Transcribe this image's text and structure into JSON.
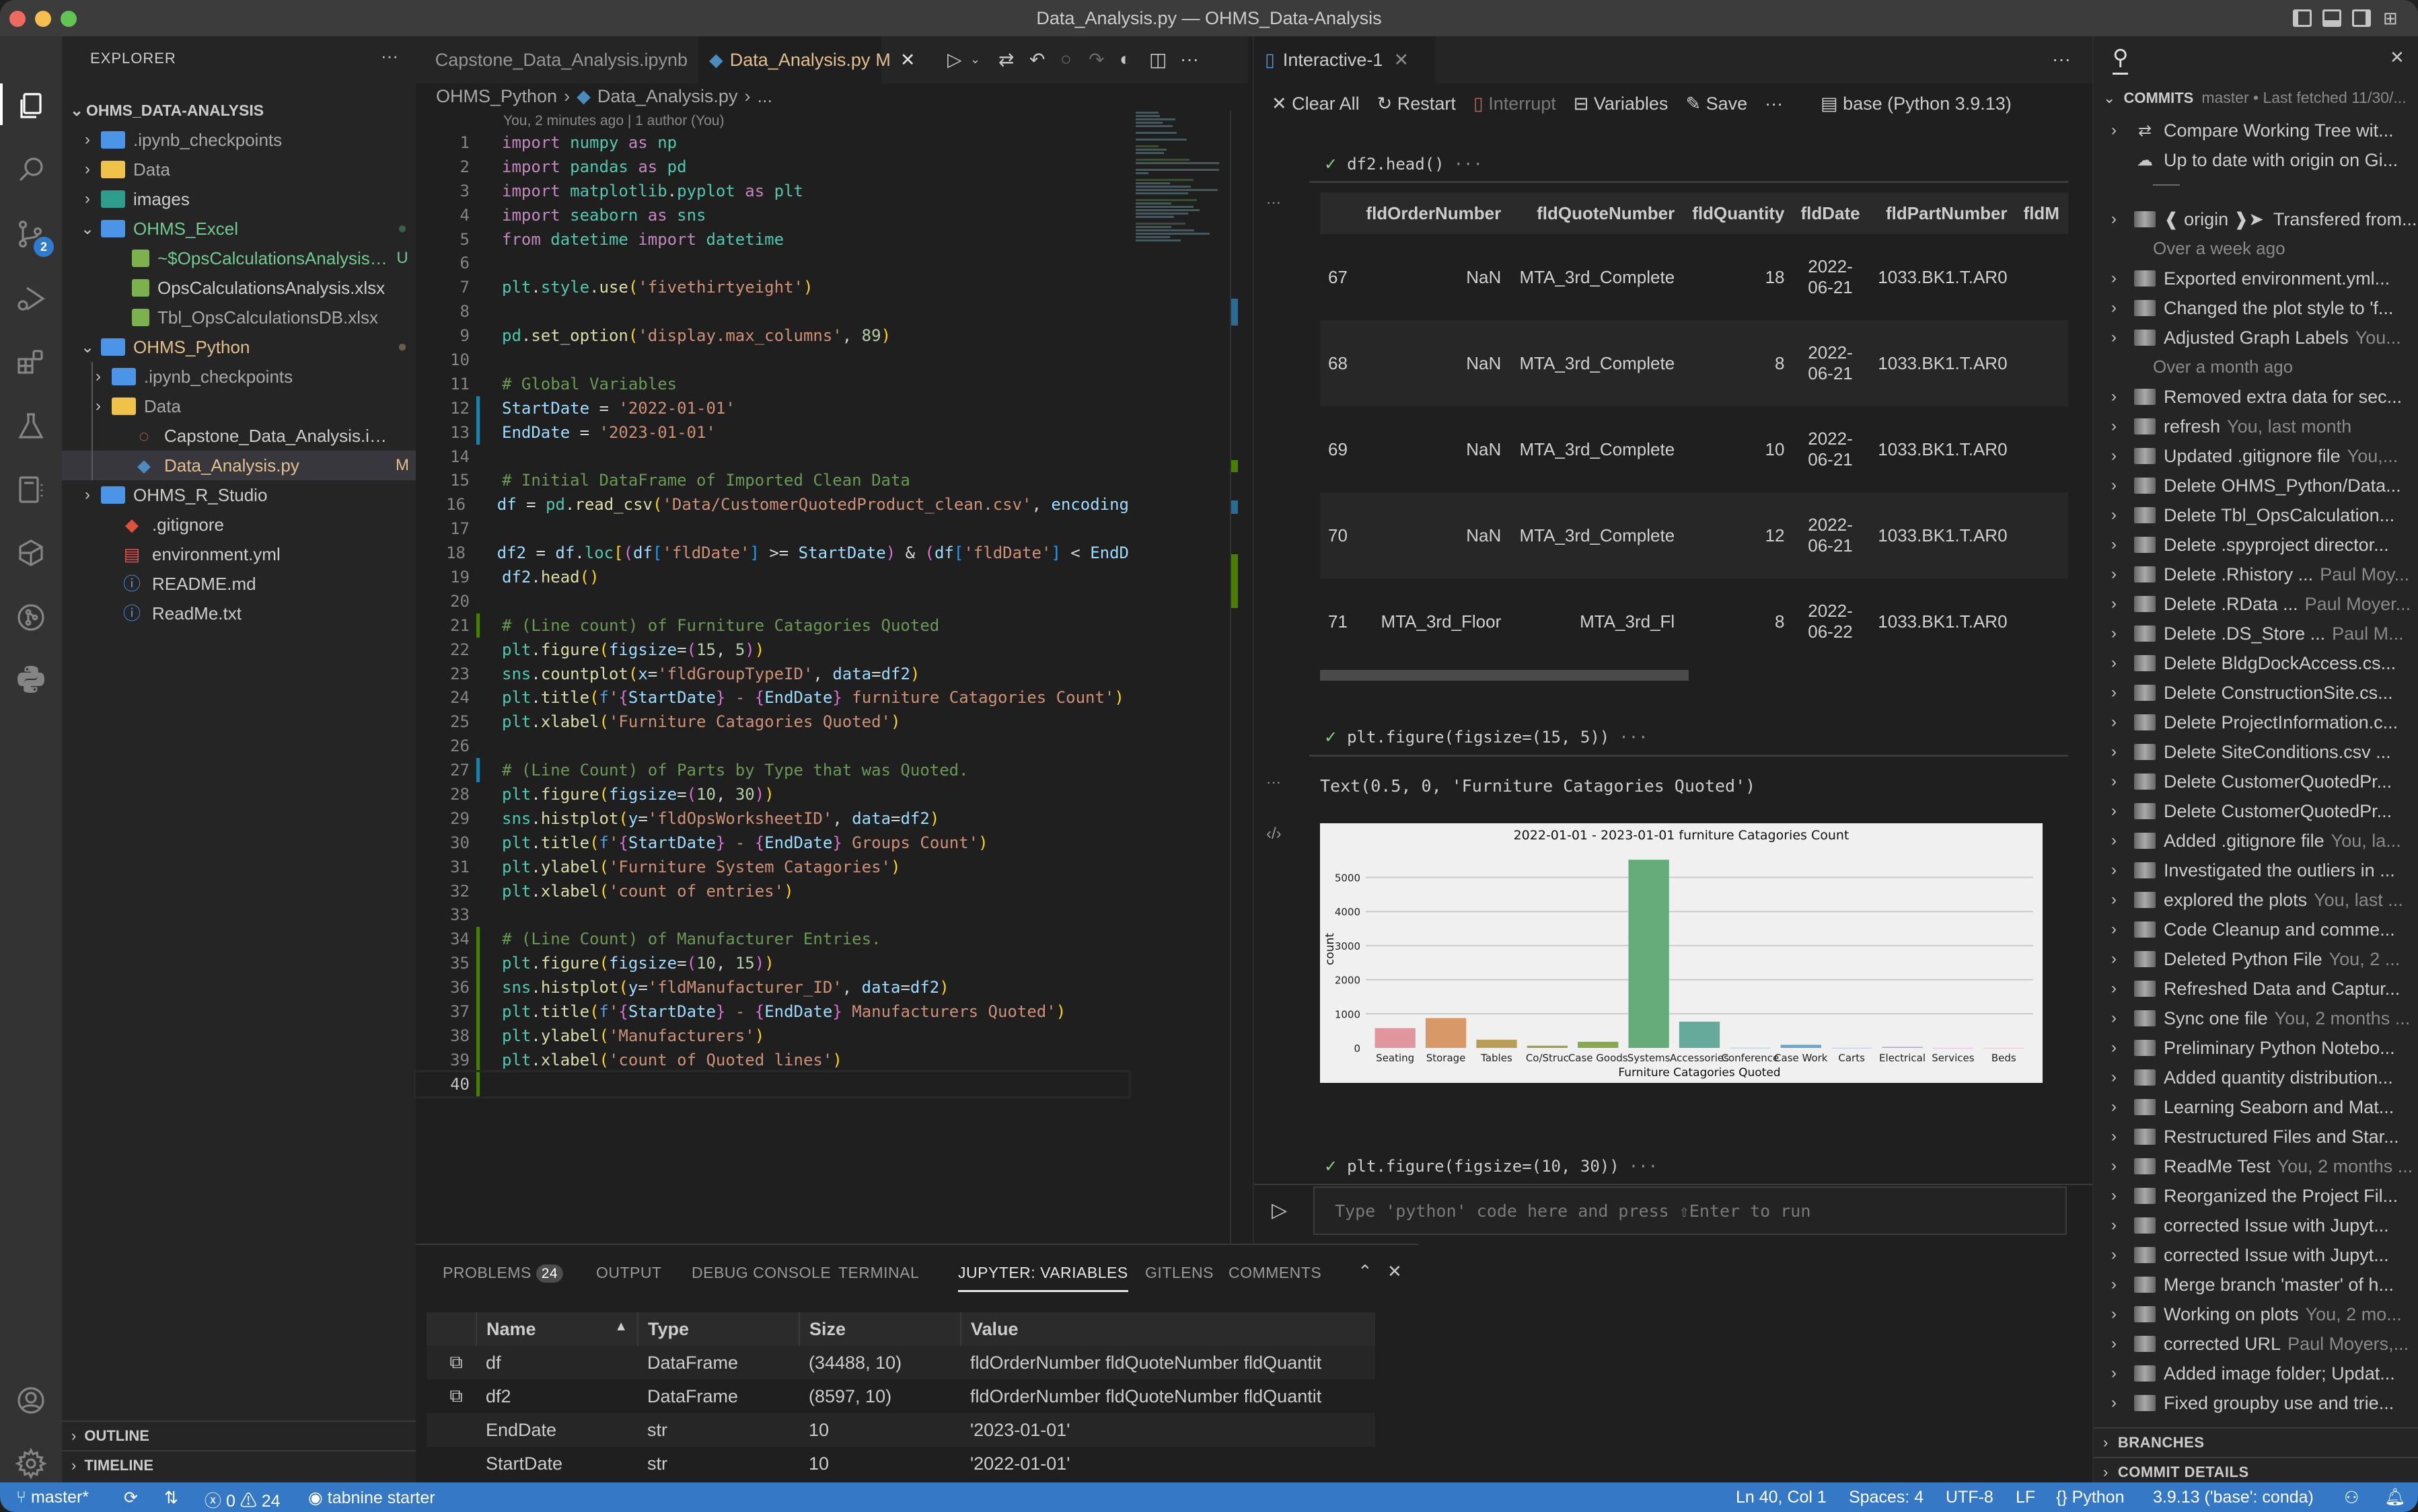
{
  "window": {
    "title": "Data_Analysis.py — OHMS_Data-Analysis"
  },
  "activity_bar": {
    "items": [
      "explorer-icon",
      "search-icon",
      "source-control-icon",
      "run-debug-icon",
      "extensions-icon",
      "testing-icon",
      "jupyter-icon",
      "remote-explorer-icon",
      "gitlens-icon",
      "python-icon",
      "account-icon",
      "settings-gear-icon"
    ],
    "source_control_badge": "2"
  },
  "explorer": {
    "header": "EXPLORER",
    "root": "OHMS_DATA-ANALYSIS",
    "items": [
      {
        "label": ".ipynb_checkpoints",
        "deco": ""
      },
      {
        "label": "Data",
        "deco": ""
      },
      {
        "label": "images",
        "deco": ""
      },
      {
        "label": "OHMS_Excel",
        "deco": "●"
      },
      {
        "label": "~$OpsCalculationsAnalysis.xlsx",
        "deco": "U"
      },
      {
        "label": "OpsCalculationsAnalysis.xlsx",
        "deco": ""
      },
      {
        "label": "Tbl_OpsCalculationsDB.xlsx",
        "deco": ""
      },
      {
        "label": "OHMS_Python",
        "deco": "●"
      },
      {
        "label": ".ipynb_checkpoints",
        "deco": ""
      },
      {
        "label": "Data",
        "deco": ""
      },
      {
        "label": "Capstone_Data_Analysis.ipynb",
        "deco": ""
      },
      {
        "label": "Data_Analysis.py",
        "deco": "M"
      },
      {
        "label": "OHMS_R_Studio",
        "deco": ""
      },
      {
        "label": ".gitignore",
        "deco": ""
      },
      {
        "label": "environment.yml",
        "deco": ""
      },
      {
        "label": "README.md",
        "deco": ""
      },
      {
        "label": "ReadMe.txt",
        "deco": ""
      }
    ],
    "outline": "OUTLINE",
    "timeline": "TIMELINE"
  },
  "editor": {
    "tabs": [
      {
        "label": "Capstone_Data_Analysis.ipynb"
      },
      {
        "label": "Data_Analysis.py",
        "status": "M"
      }
    ],
    "breadcrumb": [
      "OHMS_Python",
      "Data_Analysis.py",
      "..."
    ],
    "blame": "You, 2 minutes ago | 1 author (You)",
    "cursor_line": 40,
    "lines": [
      "import numpy as np",
      "import pandas as pd",
      "import matplotlib.pyplot as plt",
      "import seaborn as sns",
      "from datetime import datetime",
      "",
      "plt.style.use('fivethirtyeight')",
      "",
      "pd.set_option('display.max_columns', 89)",
      "",
      "# Global Variables",
      "StartDate = '2022-01-01'",
      "EndDate = '2023-01-01'",
      "",
      "# Initial DataFrame of Imported Clean Data",
      "df = pd.read_csv('Data/CustomerQuotedProduct_clean.csv', encoding",
      "",
      "df2 = df.loc[(df['fldDate'] >= StartDate) & (df['fldDate'] < EndD",
      "df2.head()",
      "",
      "# (Line count) of Furniture Catagories Quoted",
      "plt.figure(figsize=(15, 5))",
      "sns.countplot(x='fldGroupTypeID', data=df2)",
      "plt.title(f'{StartDate} - {EndDate} furniture Catagories Count')",
      "plt.xlabel('Furniture Catagories Quoted')",
      "",
      "# (Line Count) of Parts by Type that was Quoted.",
      "plt.figure(figsize=(10, 30))",
      "sns.histplot(y='fldOpsWorksheetID', data=df2)",
      "plt.title(f'{StartDate} - {EndDate} Groups Count')",
      "plt.ylabel('Furniture System Catagories')",
      "plt.xlabel('count of entries')",
      "",
      "# (Line Count) of Manufacturer Entries.",
      "plt.figure(figsize=(10, 15))",
      "sns.histplot(y='fldManufacturer_ID', data=df2)",
      "plt.title(f'{StartDate} - {EndDate} Manufacturers Quoted')",
      "plt.ylabel('Manufacturers')",
      "plt.xlabel('count of Quoted lines')",
      ""
    ]
  },
  "interactive": {
    "tab_label": "Interactive-1",
    "toolbar": {
      "clear_all": "Clear All",
      "restart": "Restart",
      "interrupt": "Interrupt",
      "variables": "Variables",
      "save": "Save",
      "kernel": "base (Python 3.9.13)"
    },
    "cell1": {
      "code": "df2.head()",
      "table": {
        "columns": [
          "",
          "fldOrderNumber",
          "fldQuoteNumber",
          "fldQuantity",
          "fldDate",
          "fldPartNumber",
          "fldM"
        ],
        "rows": [
          [
            "67",
            "NaN",
            "MTA_3rd_Complete",
            "18",
            "2022-06-21",
            "1033.BK1.T.AR0",
            ""
          ],
          [
            "68",
            "NaN",
            "MTA_3rd_Complete",
            "8",
            "2022-06-21",
            "1033.BK1.T.AR0",
            ""
          ],
          [
            "69",
            "NaN",
            "MTA_3rd_Complete",
            "10",
            "2022-06-21",
            "1033.BK1.T.AR0",
            ""
          ],
          [
            "70",
            "NaN",
            "MTA_3rd_Complete",
            "12",
            "2022-06-21",
            "1033.BK1.T.AR0",
            ""
          ],
          [
            "71",
            "MTA_3rd_Floor",
            "MTA_3rd_Fl",
            "8",
            "2022-06-22",
            "1033.BK1.T.AR0",
            ""
          ]
        ]
      }
    },
    "cell2": {
      "code": "plt.figure(figsize=(15, 5))",
      "text_output": "Text(0.5, 0, 'Furniture Catagories Quoted')"
    },
    "cell3": {
      "code": "plt.figure(figsize=(10, 30))"
    },
    "input_placeholder": "Type 'python' code here and press ⇧Enter to run"
  },
  "chart_data": {
    "type": "bar",
    "title": "2022-01-01 - 2023-01-01 furniture Catagories Count",
    "xlabel": "Furniture Catagories Quoted",
    "ylabel": "count",
    "categories": [
      "Seating",
      "Storage",
      "Tables",
      "Co/Struc",
      "Case Goods",
      "Systems",
      "Accessories",
      "Conference",
      "Case Work",
      "Carts",
      "Electrical",
      "Services",
      "Beds"
    ],
    "values": [
      580,
      875,
      240,
      65,
      180,
      5520,
      770,
      3,
      90,
      2,
      30,
      1,
      1
    ],
    "colors": [
      "#e1969e",
      "#d99868",
      "#b99c56",
      "#a09f4d",
      "#86a94f",
      "#66ac7a",
      "#66aa9b",
      "#6aa9b4",
      "#6aa5c8",
      "#8ea5da",
      "#b59ae0",
      "#d693d5",
      "#e193b5"
    ],
    "yticks": [
      0,
      1000,
      2000,
      3000,
      4000,
      5000
    ],
    "ylim": [
      0,
      5800
    ],
    "grid": true
  },
  "gitlens": {
    "header": "COMMITS",
    "branch_info": "master • Last fetched 11/30/...",
    "top_items": [
      {
        "icon": "compare-icon",
        "msg": "Compare Working Tree wit..."
      },
      {
        "icon": "cloud-icon",
        "msg": "Up to date with origin on Gi..."
      }
    ],
    "origin_commit": {
      "tag": "origin",
      "msg": "Transfered from..."
    },
    "groups": [
      {
        "label": "Over a week ago",
        "commits": [
          {
            "msg": "Exported environment.yml...",
            "meta": ""
          },
          {
            "msg": "Changed the plot style to 'f...",
            "meta": ""
          },
          {
            "msg": "Adjusted Graph Labels",
            "meta": "You..."
          }
        ]
      },
      {
        "label": "Over a month ago",
        "commits": [
          {
            "msg": "Removed extra data for sec...",
            "meta": ""
          },
          {
            "msg": "refresh",
            "meta": "You, last month"
          },
          {
            "msg": "Updated .gitignore file",
            "meta": "You,..."
          },
          {
            "msg": "Delete OHMS_Python/Data...",
            "meta": ""
          },
          {
            "msg": "Delete Tbl_OpsCalculation...",
            "meta": ""
          },
          {
            "msg": "Delete .spyproject director...",
            "meta": ""
          },
          {
            "msg": "Delete .Rhistory ...",
            "meta": "Paul Moy..."
          },
          {
            "msg": "Delete .RData ...",
            "meta": "Paul Moyer..."
          },
          {
            "msg": "Delete .DS_Store ...",
            "meta": "Paul M..."
          },
          {
            "msg": "Delete BldgDockAccess.cs...",
            "meta": ""
          },
          {
            "msg": "Delete ConstructionSite.cs...",
            "meta": ""
          },
          {
            "msg": "Delete ProjectInformation.c...",
            "meta": ""
          },
          {
            "msg": "Delete SiteConditions.csv ...",
            "meta": ""
          },
          {
            "msg": "Delete CustomerQuotedPr...",
            "meta": ""
          },
          {
            "msg": "Delete CustomerQuotedPr...",
            "meta": ""
          },
          {
            "msg": "Added .gitignore file",
            "meta": "You, la..."
          },
          {
            "msg": "Investigated the outliers in ...",
            "meta": ""
          },
          {
            "msg": "explored the plots",
            "meta": "You, last ..."
          },
          {
            "msg": "Code Cleanup and comme...",
            "meta": ""
          },
          {
            "msg": "Deleted Python File",
            "meta": "You, 2 ..."
          },
          {
            "msg": "Refreshed Data and Captur...",
            "meta": ""
          },
          {
            "msg": "Sync one file",
            "meta": "You, 2 months ..."
          },
          {
            "msg": "Preliminary Python Notebo...",
            "meta": ""
          },
          {
            "msg": "Added quantity distribution...",
            "meta": ""
          },
          {
            "msg": "Learning Seaborn and Mat...",
            "meta": ""
          },
          {
            "msg": "Restructured Files and Star...",
            "meta": ""
          },
          {
            "msg": "ReadMe Test",
            "meta": "You, 2 months ..."
          },
          {
            "msg": "Reorganized the Project Fil...",
            "meta": ""
          },
          {
            "msg": "corrected Issue with Jupyt...",
            "meta": ""
          },
          {
            "msg": "corrected Issue with Jupyt...",
            "meta": ""
          },
          {
            "msg": "Merge branch 'master' of h...",
            "meta": ""
          },
          {
            "msg": "Working on plots",
            "meta": "You, 2 mo..."
          },
          {
            "msg": "corrected URL",
            "meta": "Paul Moyers,..."
          },
          {
            "msg": "Added image folder; Updat...",
            "meta": ""
          },
          {
            "msg": "Fixed groupby use and trie...",
            "meta": ""
          }
        ]
      }
    ],
    "branches": "BRANCHES",
    "commit_details": "COMMIT DETAILS"
  },
  "panel": {
    "tabs": [
      {
        "label": "PROBLEMS",
        "badge": "24"
      },
      {
        "label": "OUTPUT"
      },
      {
        "label": "DEBUG CONSOLE"
      },
      {
        "label": "TERMINAL"
      },
      {
        "label": "JUPYTER: VARIABLES",
        "active": true
      },
      {
        "label": "GITLENS"
      },
      {
        "label": "COMMENTS"
      }
    ],
    "variables": {
      "columns": [
        "",
        "Name",
        "Type",
        "Size",
        "Value"
      ],
      "rows": [
        {
          "name": "df",
          "type": "DataFrame",
          "size": "(34488, 10)",
          "value": "fldOrderNumber fldQuoteNumber fldQuantit"
        },
        {
          "name": "df2",
          "type": "DataFrame",
          "size": "(8597, 10)",
          "value": "fldOrderNumber fldQuoteNumber fldQuantit"
        },
        {
          "name": "EndDate",
          "type": "str",
          "size": "10",
          "value": "'2023-01-01'"
        },
        {
          "name": "StartDate",
          "type": "str",
          "size": "10",
          "value": "'2022-01-01'"
        }
      ]
    }
  },
  "statusbar": {
    "branch": "master*",
    "errors": "0",
    "warnings": "24",
    "tabnine": "tabnine starter",
    "position": "Ln 40, Col 1",
    "spaces": "Spaces: 4",
    "encoding": "UTF-8",
    "eol": "LF",
    "language": "Python",
    "interpreter": "3.9.13 ('base': conda)"
  }
}
